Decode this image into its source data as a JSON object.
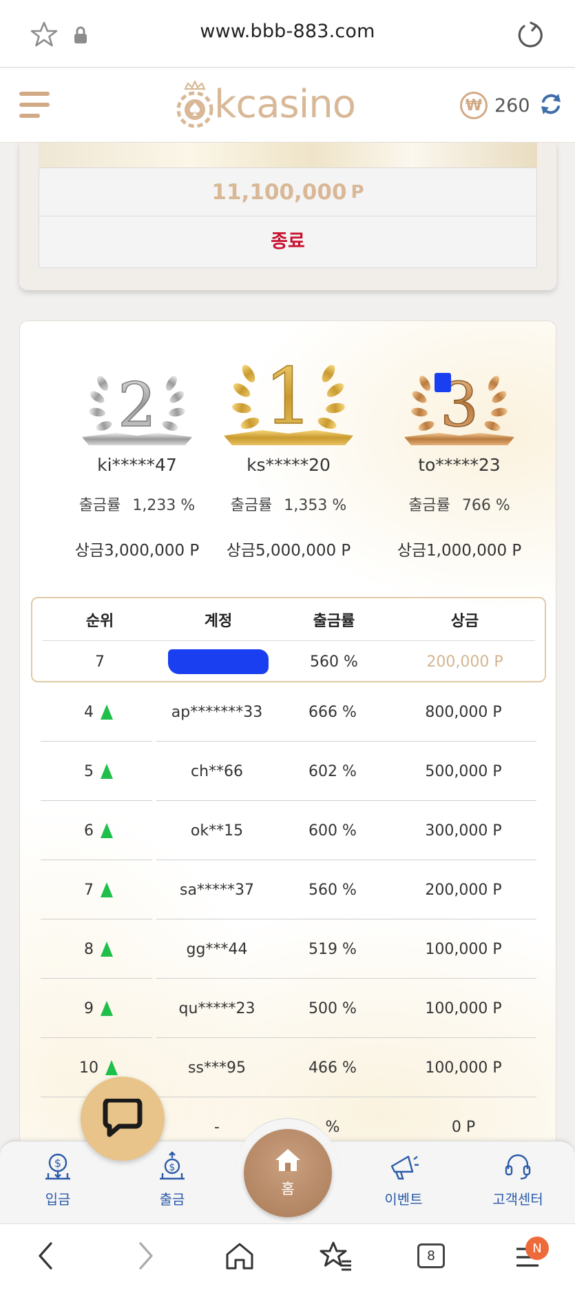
{
  "browser": {
    "url": "www.bbb-883.com",
    "tab_count": "8",
    "notification_badge": "N"
  },
  "header": {
    "logo_text": "kcasino",
    "balance": "260",
    "currency_symbol": "₩"
  },
  "jackpot": {
    "amount": "11,100,000",
    "unit": "P",
    "status": "종료"
  },
  "podium": [
    {
      "place": "2",
      "name": "ki*****47",
      "rate_label": "출금률",
      "rate": "1,233 %",
      "prize": "상금3,000,000 P"
    },
    {
      "place": "1",
      "name": "ks*****20",
      "rate_label": "출금률",
      "rate": "1,353 %",
      "prize": "상금5,000,000 P"
    },
    {
      "place": "3",
      "name": "to*****23",
      "rate_label": "출금률",
      "rate": "766 %",
      "prize": "상금1,000,000 P"
    }
  ],
  "table": {
    "headers": {
      "rank": "순위",
      "account": "계정",
      "rate": "출금률",
      "prize": "상금"
    },
    "my_row": {
      "rank": "7",
      "account": "",
      "rate": "560 %",
      "prize": "200,000 P"
    },
    "rows": [
      {
        "rank": "4",
        "account": "ap*******33",
        "rate": "666 %",
        "prize": "800,000 P",
        "trend": "up"
      },
      {
        "rank": "5",
        "account": "ch**66",
        "rate": "602 %",
        "prize": "500,000 P",
        "trend": "up"
      },
      {
        "rank": "6",
        "account": "ok**15",
        "rate": "600 %",
        "prize": "300,000 P",
        "trend": "up"
      },
      {
        "rank": "7",
        "account": "sa*****37",
        "rate": "560 %",
        "prize": "200,000 P",
        "trend": "up"
      },
      {
        "rank": "8",
        "account": "gg***44",
        "rate": "519 %",
        "prize": "100,000 P",
        "trend": "up"
      },
      {
        "rank": "9",
        "account": "qu*****23",
        "rate": "500 %",
        "prize": "100,000 P",
        "trend": "up"
      },
      {
        "rank": "10",
        "account": "ss***95",
        "rate": "466 %",
        "prize": "100,000 P",
        "trend": "up"
      },
      {
        "rank": "",
        "account": "-",
        "rate": "%",
        "prize": "0 P",
        "trend": ""
      }
    ]
  },
  "bottom_nav": {
    "deposit": "입금",
    "withdraw": "출금",
    "home": "홈",
    "event": "이벤트",
    "support": "고객센터"
  },
  "colors": {
    "accent_gold": "#d2a985",
    "prize_text": "#d3b590",
    "status_red": "#c8102e",
    "trend_up_green": "#1fbf4a",
    "nav_blue": "#2a5aa8",
    "redaction_blue": "#1a3ff0"
  }
}
